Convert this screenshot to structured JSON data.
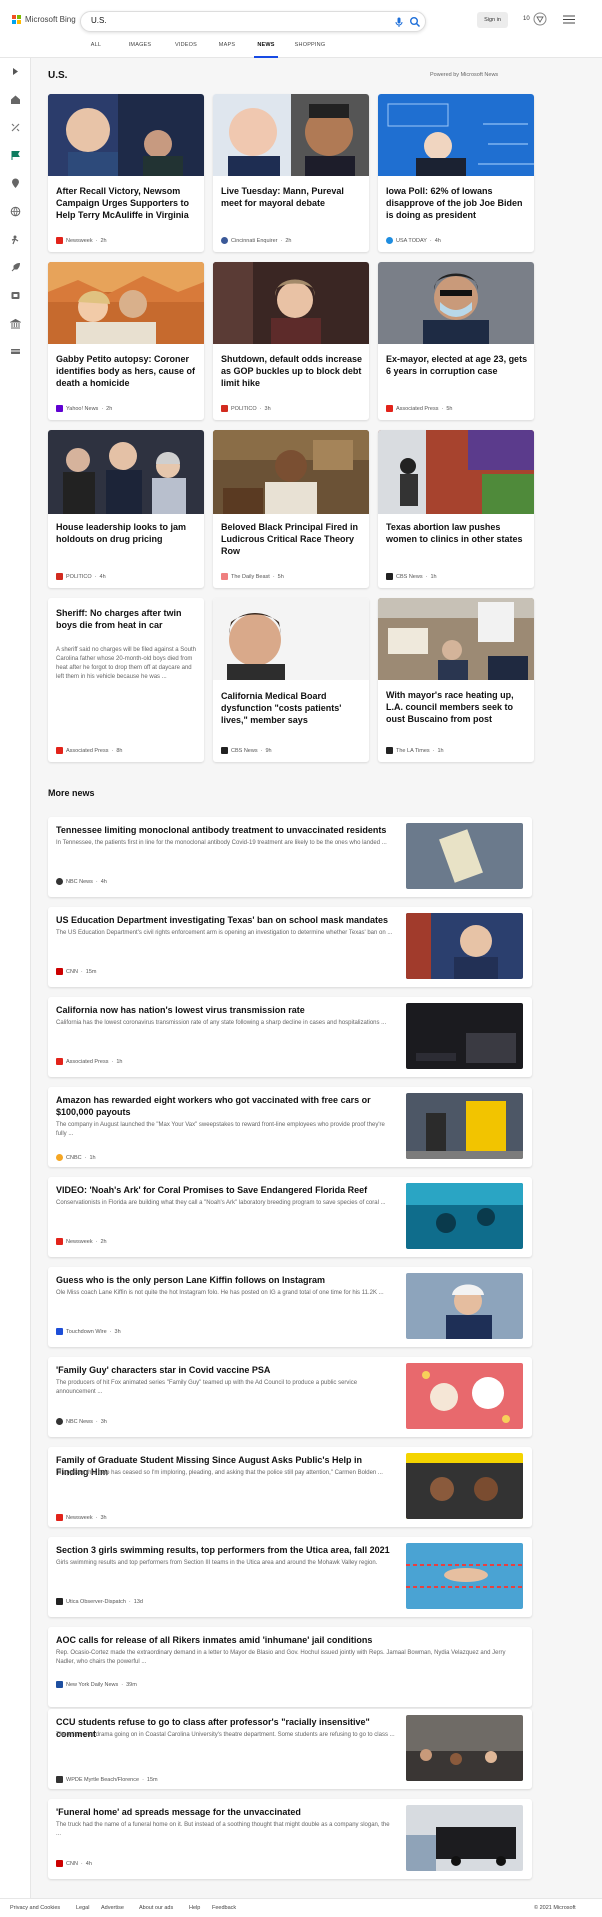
{
  "brand": "Microsoft Bing",
  "search": {
    "query": "U.S."
  },
  "header": {
    "sign_in": "Sign in",
    "rewards_count": "10"
  },
  "tabs": [
    "ALL",
    "IMAGES",
    "VIDEOS",
    "MAPS",
    "NEWS",
    "SHOPPING"
  ],
  "active_tab": "NEWS",
  "section": {
    "title": "U.S.",
    "powered_by": "Powered by Microsoft News"
  },
  "cards": [
    {
      "title": "After Recall Victory, Newsom Campaign Urges Supporters to Help Terry McAuliffe in Virginia",
      "source": "Newsweek",
      "time": "2h",
      "fav_color": "#e2231a"
    },
    {
      "title": "Live Tuesday: Mann, Pureval meet for mayoral debate",
      "source": "Cincinnati Enquirer",
      "time": "2h",
      "fav_color": "#3b5998"
    },
    {
      "title": "Iowa Poll: 62% of Iowans disapprove of the job Joe Biden is doing as president",
      "source": "USA TODAY",
      "time": "4h",
      "fav_color": "#1e8de0"
    },
    {
      "title": "Gabby Petito autopsy: Coroner identifies body as hers, cause of death a homicide",
      "source": "Yahoo! News",
      "time": "2h",
      "fav_color": "#6001d2"
    },
    {
      "title": "Shutdown, default odds increase as GOP buckles up to block debt limit hike",
      "source": "POLITICO",
      "time": "3h",
      "fav_color": "#d22b1f"
    },
    {
      "title": "Ex-mayor, elected at age 23, gets 6 years in corruption case",
      "source": "Associated Press",
      "time": "5h",
      "fav_color": "#e2231a"
    },
    {
      "title": "House leadership looks to jam holdouts on drug pricing",
      "source": "POLITICO",
      "time": "4h",
      "fav_color": "#d22b1f"
    },
    {
      "title": "Beloved Black Principal Fired in Ludicrous Critical Race Theory Row",
      "source": "The Daily Beast",
      "time": "5h",
      "fav_color": "#ef7f7f"
    },
    {
      "title": "Texas abortion law pushes women to clinics in other states",
      "source": "CBS News",
      "time": "1h",
      "fav_color": "#222222"
    },
    {
      "title": "Sheriff: No charges after twin boys die from heat in car",
      "snippet": "A sheriff said no charges will be filed against a South Carolina father whose 20-month-old boys died from heat after he forgot to drop them off at daycare and left them in his vehicle because he was ...",
      "source": "Associated Press",
      "time": "8h",
      "fav_color": "#e2231a"
    },
    {
      "title": "California Medical Board dysfunction \"costs patients' lives,\" member says",
      "source": "CBS News",
      "time": "9h",
      "fav_color": "#222222"
    },
    {
      "title": "With mayor's race heating up, L.A. council members seek to oust Buscaino from post",
      "source": "The LA Times",
      "time": "1h",
      "fav_color": "#222222"
    }
  ],
  "more_news": {
    "title": "More news",
    "stories": [
      {
        "title": "Tennessee limiting monoclonal antibody treatment to unvaccinated residents",
        "snippet": "In Tennessee, the patients first in line for the monoclonal antibody Covid-19 treatment are likely to be the ones who landed ...",
        "source": "NBC News",
        "time": "4h",
        "fav_color": "#333333"
      },
      {
        "title": "US Education Department investigating Texas' ban on school mask mandates",
        "snippet": "The US Education Department's civil rights enforcement arm is opening an investigation to determine whether Texas' ban on ...",
        "source": "CNN",
        "time": "15m",
        "fav_color": "#cc0000"
      },
      {
        "title": "California now has nation's lowest virus transmission rate",
        "snippet": "California has the lowest coronavirus transmission rate of any state following a sharp decline in cases and hospitalizations ...",
        "source": "Associated Press",
        "time": "1h",
        "fav_color": "#e2231a"
      },
      {
        "title": "Amazon has rewarded eight workers who got vaccinated with free cars or $100,000 payouts",
        "snippet": "The company in August launched the \"Max Your Vax\" sweepstakes to reward front-line employees who provide proof they're fully ...",
        "source": "CNBC",
        "time": "1h",
        "fav_color": "#f5a623"
      },
      {
        "title": "VIDEO: 'Noah's Ark' for Coral Promises to Save Endangered Florida Reef",
        "snippet": "Conservationists in Florida are building what they call a \"Noah's Ark\" laboratory breeding program to save species of coral ...",
        "source": "Newsweek",
        "time": "2h",
        "fav_color": "#e2231a"
      },
      {
        "title": "Guess who is the only person Lane Kiffin follows on Instagram",
        "snippet": "Ole Miss coach Lane Kiffin is not quite the hot Instagram folo. He has posted on IG a grand total of one time for his 11.2K ...",
        "source": "Touchdown Wire",
        "time": "3h",
        "fav_color": "#1d4ed8"
      },
      {
        "title": "'Family Guy' characters star in Covid vaccine PSA",
        "snippet": "The producers of hit Fox animated series \"Family Guy\" teamed up with the Ad Council to produce a public service announcement ...",
        "source": "NBC News",
        "time": "3h",
        "fav_color": "#333333"
      },
      {
        "title": "Family of Graduate Student Missing Since August Asks Public's Help in Finding Him",
        "snippet": "\"It appears that help has ceased so I'm imploring, pleading, and asking that the police still pay attention,\" Carmen Bolden ...",
        "source": "Newsweek",
        "time": "3h",
        "fav_color": "#e2231a"
      },
      {
        "title": "Section 3 girls swimming results, top performers from the Utica area, fall 2021",
        "snippet": "Girls swimming results and top performers from Section III teams in the Utica area and around the Mohawk Valley region.",
        "source": "Utica Observer-Dispatch",
        "time": "13d",
        "fav_color": "#222222"
      },
      {
        "title": "AOC calls for release of all Rikers inmates amid 'inhumane' jail conditions",
        "snippet": "Rep. Ocasio-Cortez made the extraordinary demand in a letter to Mayor de Blasio and Gov. Hochul issued jointly with Reps. Jamaal Bowman, Nydia Velazquez and Jerry Nadler, who chairs the powerful ...",
        "source": "New York Daily News",
        "time": "39m",
        "fav_color": "#1e4fa0"
      },
      {
        "title": "CCU students refuse to go to class after professor's \"racially insensitive\" comment",
        "snippet": "There is some drama going on in Coastal Carolina University's theatre department. Some students are refusing to go to class ...",
        "source": "WPDE Myrtle Beach/Florence",
        "time": "15m",
        "fav_color": "#333333"
      },
      {
        "title": "'Funeral home' ad spreads message for the unvaccinated",
        "snippet": "The truck had the name of a funeral home on it. But instead of a soothing thought that might double as a company slogan, the ...",
        "source": "CNN",
        "time": "4h",
        "fav_color": "#cc0000"
      }
    ]
  },
  "footer": {
    "links": [
      "Privacy and Cookies",
      "Legal",
      "Advertise",
      "About our ads",
      "Help",
      "Feedback"
    ],
    "copyright": "© 2021 Microsoft"
  }
}
